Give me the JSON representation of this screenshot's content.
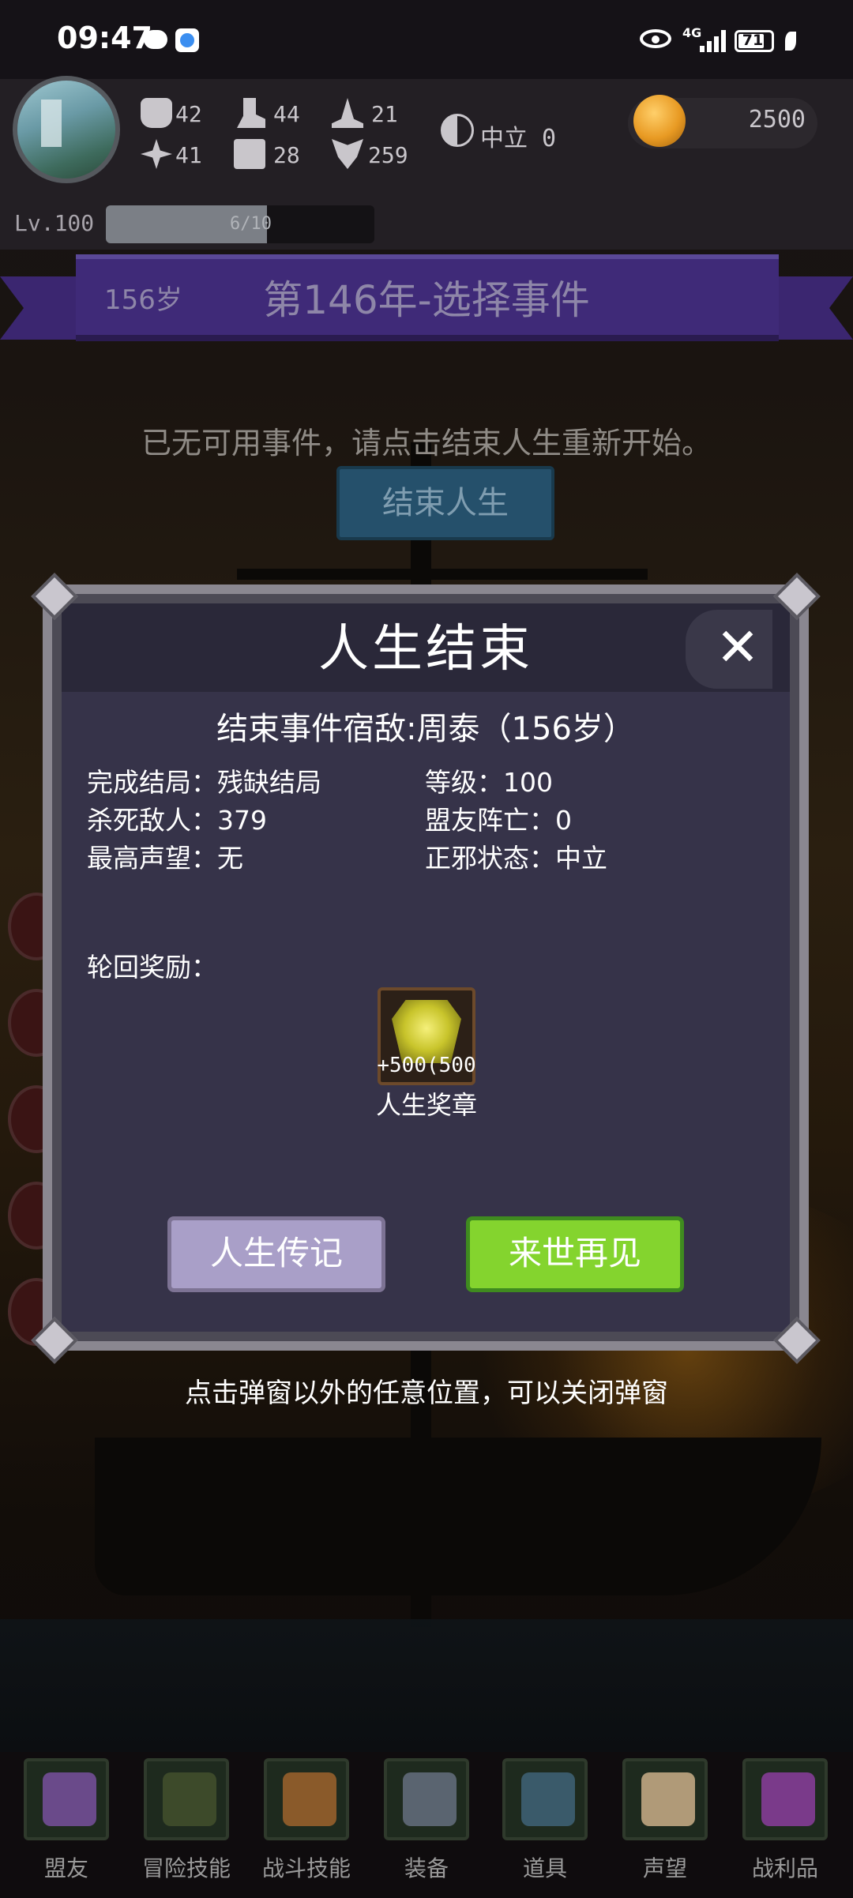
{
  "status_bar": {
    "time": "09:47",
    "network": "4G",
    "battery": "71"
  },
  "player": {
    "stats": {
      "strength": "42",
      "agility": "44",
      "intelligence": "21",
      "luck": "41",
      "defense": "28",
      "spirit": "259"
    },
    "alignment": "中立 0",
    "gold": "2500",
    "level": "Lv.100",
    "xp_text": "6/10",
    "xp_fraction": 0.6
  },
  "banner": {
    "age": "156岁",
    "title": "第146年-选择事件"
  },
  "notice": "已无可用事件，请点击结束人生重新开始。",
  "end_life_button": "结束人生",
  "modal": {
    "title": "人生结束",
    "close_symbol": "✕",
    "summary": "结束事件宿敌:周泰（156岁）",
    "info": [
      [
        "完成结局：残缺结局",
        "等级：100"
      ],
      [
        "杀死敌人：379",
        "盟友阵亡：0"
      ],
      [
        "最高声望：无",
        "正邪状态：中立"
      ]
    ],
    "reward_label": "轮回奖励：",
    "reward": {
      "value": "+500(500",
      "name": "人生奖章"
    },
    "biography_button": "人生传记",
    "next_life_button": "来世再见"
  },
  "hint": "点击弹窗以外的任意位置，可以关闭弹窗",
  "nav": [
    {
      "label": "盟友",
      "icon": "handshake-icon",
      "color": "#6a4a8a"
    },
    {
      "label": "冒险技能",
      "icon": "book-icon",
      "color": "#3d4a2a"
    },
    {
      "label": "战斗技能",
      "icon": "backpack-icon",
      "color": "#8a5a2a"
    },
    {
      "label": "装备",
      "icon": "swords-icon",
      "color": "#5a6470"
    },
    {
      "label": "道具",
      "icon": "pouch-icon",
      "color": "#3a5a6a"
    },
    {
      "label": "声望",
      "icon": "scroll-icon",
      "color": "#b09a78"
    },
    {
      "label": "战利品",
      "icon": "treasure-chest-icon",
      "color": "#7a3a8a"
    }
  ],
  "colors": {
    "banner": "#3f2a78",
    "modal_bg": "#363349",
    "primary_green": "#84d42e",
    "secondary_lavender": "#a99fc8"
  }
}
